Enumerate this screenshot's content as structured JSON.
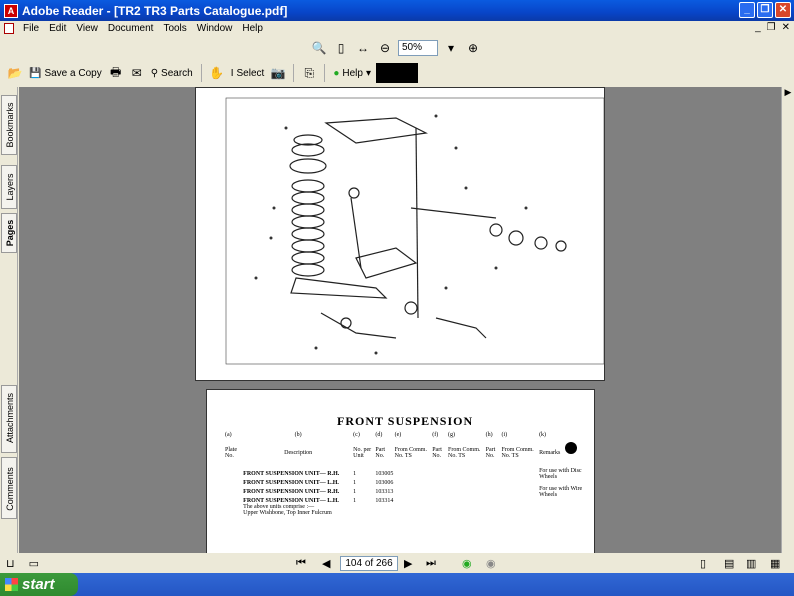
{
  "window": {
    "title": "Adobe Reader - [TR2 TR3 Parts Catalogue.pdf]"
  },
  "menu": [
    "File",
    "Edit",
    "View",
    "Document",
    "Tools",
    "Window",
    "Help"
  ],
  "zoom": {
    "value": "50%"
  },
  "toolbar": {
    "save_copy": "Save a Copy",
    "search": "Search",
    "select": "Select",
    "help": "Help"
  },
  "sidebar": {
    "tabs": [
      "Bookmarks",
      "Layers",
      "Pages",
      "Attachments",
      "Comments"
    ]
  },
  "document": {
    "page2_title": "FRONT SUSPENSION",
    "table_headers": [
      "(a)",
      "(b)",
      "(c)",
      "(d)",
      "(e)",
      "(f)",
      "(g)",
      "(h)",
      "(i)",
      "(k)"
    ],
    "col_labels": [
      "Plate No.",
      "Description",
      "No. per Unit",
      "Part No.",
      "From Comm. No. TS",
      "Part No.",
      "From Comm. No. TS",
      "Part No.",
      "From Comm. No. TS",
      "Remarks"
    ],
    "rows": [
      {
        "desc": "FRONT SUSPENSION UNIT— R.H.",
        "qty": "1",
        "part": "103005",
        "remark": "For use with Disc Wheels"
      },
      {
        "desc": "FRONT SUSPENSION UNIT— L.H.",
        "qty": "1",
        "part": "103006",
        "remark": ""
      },
      {
        "desc": "FRONT SUSPENSION UNIT— R.H.",
        "qty": "1",
        "part": "103313",
        "remark": "For use with Wire Wheels"
      },
      {
        "desc": "FRONT SUSPENSION UNIT— L.H.",
        "qty": "1",
        "part": "103314",
        "remark": ""
      }
    ],
    "row_note": "The above units comprise :—",
    "row_note2": "Upper Wishbone, Top Inner Fulcrum"
  },
  "status": {
    "page_indicator": "104 of 266"
  },
  "taskbar": {
    "start": "start"
  }
}
